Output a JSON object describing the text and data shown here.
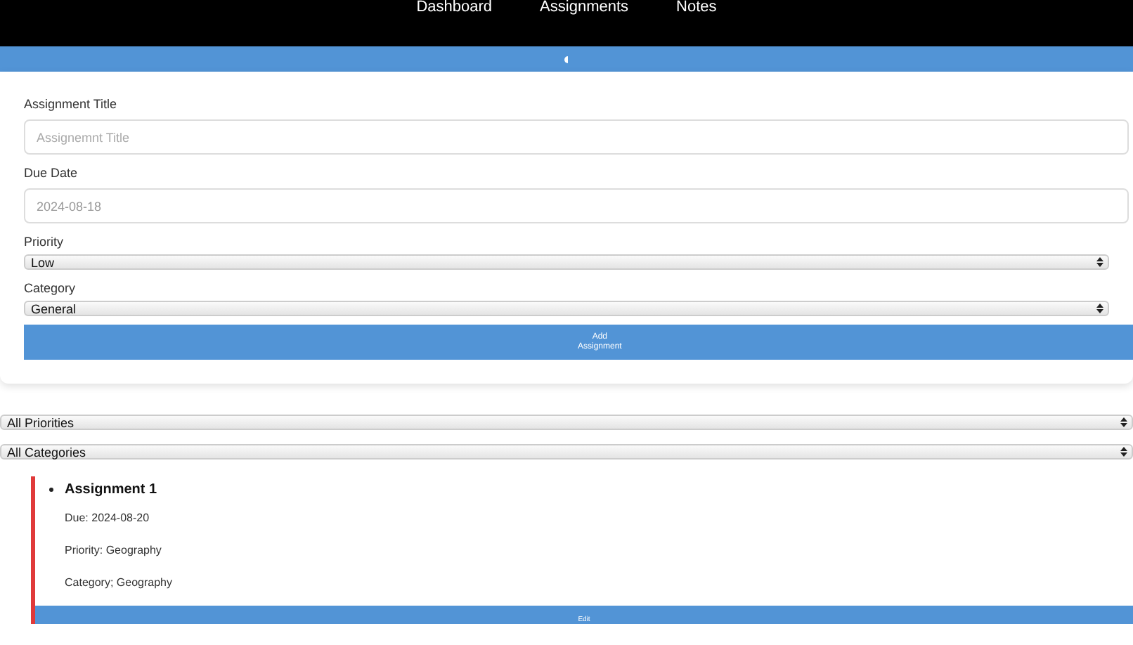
{
  "nav": {
    "links": [
      {
        "label": "Dashboard",
        "selected": false
      },
      {
        "label": "Assignments",
        "selected": false
      },
      {
        "label": "Notes",
        "selected": false
      }
    ]
  },
  "form": {
    "title_label": "Assignment Title",
    "title_placeholder": "Assignemnt Title",
    "due_label": "Due Date",
    "due_value": "2024-08-18",
    "priority_label": "Priority",
    "priority_value": "Low",
    "category_label": "Category",
    "category_value": "General",
    "submit": "Add\nAssignment"
  },
  "filters": [
    {
      "value": "All Priorities"
    },
    {
      "value": "All Categories"
    }
  ],
  "assignments": [
    {
      "title": "Assignment 1",
      "due": "Due: 2024-08-20",
      "priority": "Priority: Geography",
      "category": "Category; Geography",
      "color": "#e03a3a",
      "edit": "Edit"
    }
  ]
}
